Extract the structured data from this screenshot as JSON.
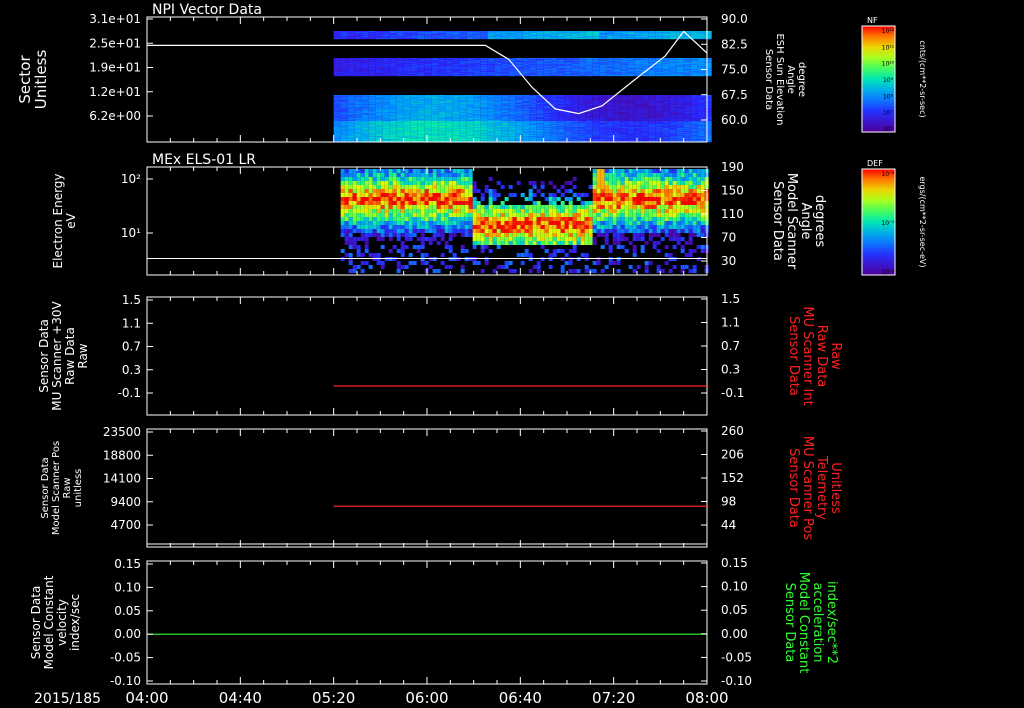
{
  "date_label": "2015/185",
  "x_ticks": [
    "04:00",
    "04:40",
    "05:20",
    "06:00",
    "06:40",
    "07:20",
    "08:00"
  ],
  "panels": [
    {
      "title": "NPI Vector Data",
      "left_label": [
        "Sector",
        "Unitless"
      ],
      "left_ticks": [
        "3.1e+01",
        "2.5e+01",
        "1.9e+01",
        "1.2e+01",
        "6.2e+00"
      ],
      "right_label": [
        "Sensor Data",
        "ESH Sun Elevation",
        "Angle",
        "degree"
      ],
      "right_ticks": [
        "90.0",
        "82.5",
        "75.0",
        "67.5",
        "60.0"
      ],
      "colorbar": {
        "label": "NF",
        "unit": "cnts/(cm**2-sr-sec)",
        "ticks": [
          "10¹²",
          "10¹¹",
          "10¹⁰",
          "10⁹",
          "10⁸",
          "10⁷",
          "10⁶"
        ]
      }
    },
    {
      "title": "MEx ELS-01 LR",
      "left_label": [
        "Electron Energy",
        "eV"
      ],
      "left_ticks": [
        "10²",
        "10¹"
      ],
      "right_label": [
        "Sensor Data",
        "Model Scanner",
        "Angle",
        "degrees"
      ],
      "right_ticks": [
        "190",
        "150",
        "110",
        "70",
        "30"
      ],
      "colorbar": {
        "label": "DEF",
        "unit": "ergs/(cm**2-sr-sec-eV)",
        "ticks": [
          "10⁻⁴",
          "10⁻⁵",
          "10⁻⁶"
        ]
      }
    },
    {
      "left_label": [
        "Sensor Data",
        "MU Scanner +30V",
        "Raw Data",
        "Raw"
      ],
      "left_ticks": [
        "1.5",
        "1.1",
        "0.7",
        "0.3",
        "-0.1"
      ],
      "right_label": [
        "Sensor Data",
        "MU Scanner Int",
        "Raw Data",
        "Raw"
      ],
      "right_ticks": [
        "1.5",
        "1.1",
        "0.7",
        "0.3",
        "-0.1"
      ]
    },
    {
      "left_label": [
        "Sensor Data",
        "Model Scanner Pos",
        "Raw",
        "unitless"
      ],
      "left_ticks": [
        "23500",
        "18800",
        "14100",
        "9400",
        "4700"
      ],
      "right_label": [
        "Sensor Data",
        "MU Scanner Pos",
        "Telemetry",
        "Unitless"
      ],
      "right_ticks": [
        "260",
        "206",
        "152",
        "98",
        "44"
      ]
    },
    {
      "left_label": [
        "Sensor Data",
        "Model Constant",
        "velocity",
        "index/sec"
      ],
      "left_ticks": [
        "0.15",
        "0.10",
        "0.05",
        "0.00",
        "-0.05",
        "-0.10"
      ],
      "right_label": [
        "Sensor Data",
        "Model Constant",
        "acceleration",
        "index/sec**2"
      ],
      "right_ticks": [
        "0.15",
        "0.10",
        "0.05",
        "0.00",
        "-0.05",
        "-0.10"
      ]
    }
  ],
  "colors": {
    "background": "#000000",
    "axis": "#ffffff",
    "red_trace": "#ff2020",
    "green_trace": "#30ff30"
  },
  "chart_data": [
    {
      "type": "heatmap",
      "title": "NPI Vector Data",
      "xlabel": "2015/185",
      "ylabel": "Sector Unitless",
      "x_range": [
        "04:00",
        "08:00"
      ],
      "y_range": [
        0,
        31
      ],
      "data_start": "05:20",
      "series": [
        {
          "name": "Sensor Data ESH Sun Elevation Angle degree",
          "axis": "right",
          "ylim": [
            55.5,
            90.0
          ],
          "x": [
            "04:00",
            "06:25",
            "06:35",
            "06:45",
            "06:55",
            "07:05",
            "07:15",
            "07:30",
            "07:42",
            "07:50",
            "08:00"
          ],
          "values": [
            81.5,
            81.5,
            77,
            68,
            61,
            59.5,
            62,
            71,
            78,
            86,
            79
          ]
        }
      ]
    },
    {
      "type": "heatmap",
      "title": "MEx ELS-01 LR",
      "ylabel": "Electron Energy eV",
      "yscale": "log",
      "x_range": [
        "04:00",
        "08:00"
      ],
      "data_start": "05:23",
      "series": [
        {
          "name": "Sensor Data Model Scanner Angle degrees",
          "axis": "right",
          "ylim": [
            0,
            190
          ],
          "x": [
            "04:00",
            "08:00"
          ],
          "values": [
            5,
            5
          ]
        }
      ]
    },
    {
      "type": "line",
      "ylim": [
        -0.3,
        1.5
      ],
      "series": [
        {
          "name": "Sensor Data MU Scanner Int Raw Data Raw",
          "axis": "right",
          "x": [
            "05:20",
            "08:00"
          ],
          "values": [
            -0.1,
            -0.1
          ]
        }
      ]
    },
    {
      "type": "line",
      "left_ylim": [
        0,
        23500
      ],
      "right_ylim": [
        0,
        260
      ],
      "series": [
        {
          "name": "Sensor Data MU Scanner Pos Telemetry Unitless",
          "axis": "right",
          "x": [
            "05:20",
            "08:00"
          ],
          "values": [
            87,
            87
          ]
        }
      ]
    },
    {
      "type": "line",
      "ylim": [
        -0.1,
        0.15
      ],
      "series": [
        {
          "name": "Sensor Data Model Constant velocity index/sec",
          "axis": "left",
          "x": [
            "04:00",
            "08:00"
          ],
          "values": [
            0.0,
            0.0
          ]
        }
      ]
    }
  ]
}
